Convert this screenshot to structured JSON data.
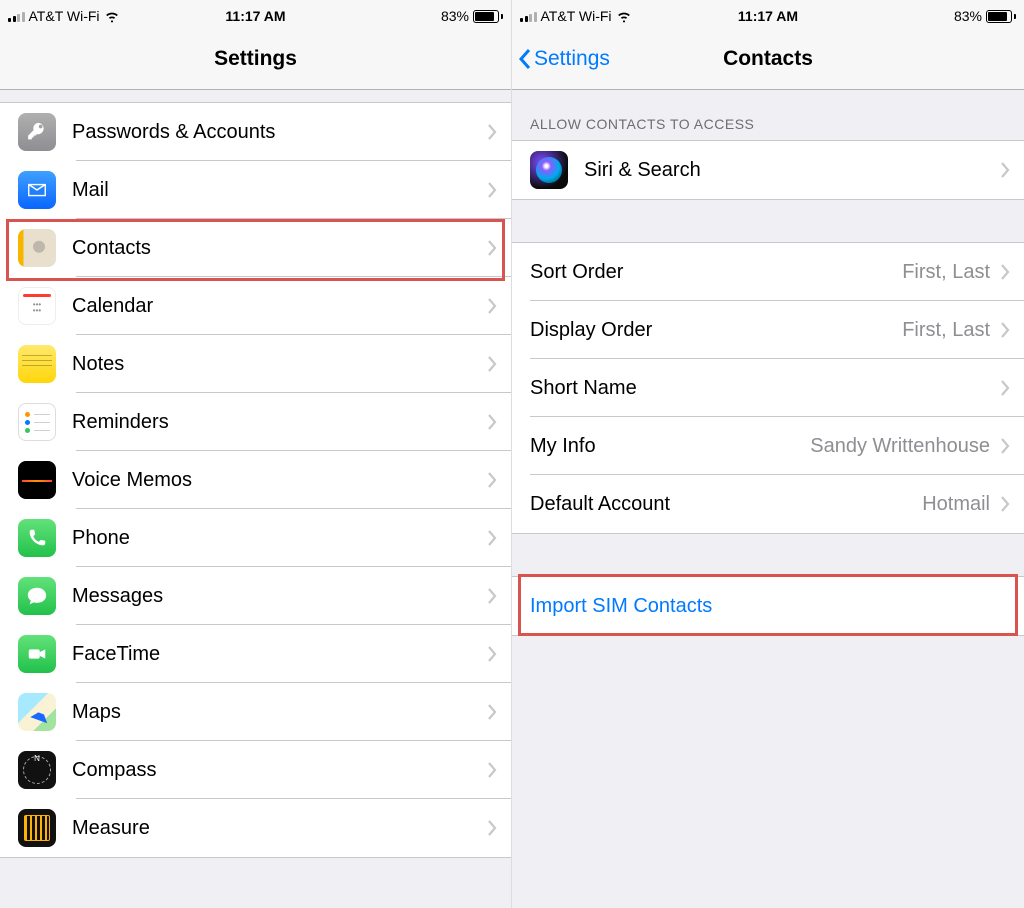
{
  "status": {
    "carrier": "AT&T Wi-Fi",
    "time": "11:17 AM",
    "battery_pct": "83%"
  },
  "left": {
    "title": "Settings",
    "rows": [
      {
        "id": "passwords",
        "label": "Passwords & Accounts"
      },
      {
        "id": "mail",
        "label": "Mail"
      },
      {
        "id": "contacts",
        "label": "Contacts"
      },
      {
        "id": "calendar",
        "label": "Calendar"
      },
      {
        "id": "notes",
        "label": "Notes"
      },
      {
        "id": "reminders",
        "label": "Reminders"
      },
      {
        "id": "voicememos",
        "label": "Voice Memos"
      },
      {
        "id": "phone",
        "label": "Phone"
      },
      {
        "id": "messages",
        "label": "Messages"
      },
      {
        "id": "facetime",
        "label": "FaceTime"
      },
      {
        "id": "maps",
        "label": "Maps"
      },
      {
        "id": "compass",
        "label": "Compass"
      },
      {
        "id": "measure",
        "label": "Measure"
      }
    ]
  },
  "right": {
    "back": "Settings",
    "title": "Contacts",
    "section_header": "ALLOW CONTACTS TO ACCESS",
    "siri": "Siri & Search",
    "rows": [
      {
        "label": "Sort Order",
        "value": "First, Last"
      },
      {
        "label": "Display Order",
        "value": "First, Last"
      },
      {
        "label": "Short Name",
        "value": ""
      },
      {
        "label": "My Info",
        "value": "Sandy Writtenhouse"
      },
      {
        "label": "Default Account",
        "value": "Hotmail"
      }
    ],
    "import": "Import SIM Contacts"
  }
}
